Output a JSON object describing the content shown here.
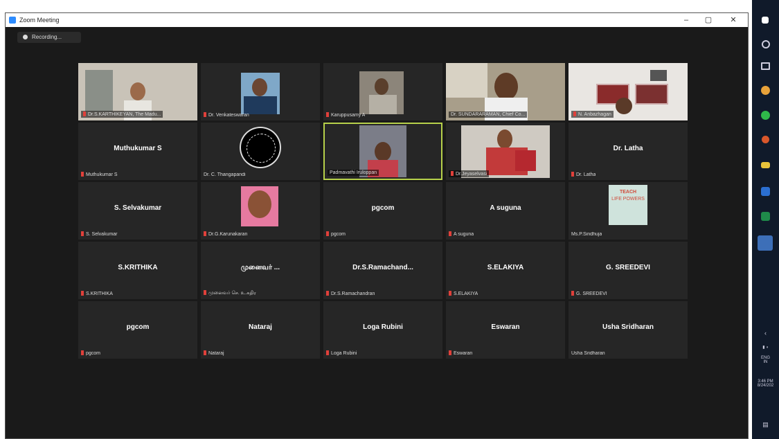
{
  "window": {
    "title": "Zoom Meeting"
  },
  "recording": {
    "label": "Recording..."
  },
  "participants": [
    {
      "display": "",
      "label": "Dr.S.KARTHIKEYAN, The Madu..."
    },
    {
      "display": "",
      "label": "Dr. Venkateswaran"
    },
    {
      "display": "",
      "label": "Karuppusamy A"
    },
    {
      "display": "",
      "label": "Dr. SUNDARARAMAN, Chief Co..."
    },
    {
      "display": "",
      "label": "N. Anbazhagan"
    },
    {
      "display": "Muthukumar S",
      "label": "Muthukumar S"
    },
    {
      "display": "",
      "label": "Dr. C. Thangapandi"
    },
    {
      "display": "",
      "label": "Padmavathi Iruloppan"
    },
    {
      "display": "",
      "label": "Dr.Jeyaselvasi"
    },
    {
      "display": "Dr. Latha",
      "label": "Dr. Latha"
    },
    {
      "display": "S. Selvakumar",
      "label": "S. Selvakumar"
    },
    {
      "display": "",
      "label": "Dr.G.Karunakaran"
    },
    {
      "display": "pgcom",
      "label": "pgcom"
    },
    {
      "display": "A suguna",
      "label": "A suguna"
    },
    {
      "display": "",
      "label": "Ms.P.Sindhuja"
    },
    {
      "display": "S.KRITHIKA",
      "label": "S.KRITHIKA"
    },
    {
      "display": "முனைவர் ...",
      "label": "முனைவர் செ. உ.கதிர"
    },
    {
      "display": "Dr.S.Ramachand...",
      "label": "Dr.S.Ramachandran"
    },
    {
      "display": "S.ELAKIYA",
      "label": "S.ELAKIYA"
    },
    {
      "display": "G. SREEDEVI",
      "label": "G. SREEDEVI"
    },
    {
      "display": "pgcom",
      "label": "pgcom"
    },
    {
      "display": "Nataraj",
      "label": "Nataraj"
    },
    {
      "display": "Loga Rubini",
      "label": "Loga Rubini"
    },
    {
      "display": "Eswaran",
      "label": "Eswaran"
    },
    {
      "display": "Usha Sridharan",
      "label": "Usha Sridharan"
    }
  ],
  "poster": {
    "line1": "TEACH",
    "line2": "LIFE POWERS"
  },
  "tray": {
    "lang": "ENG",
    "region": "IN",
    "time": "3:46 PM",
    "date": "8/24/202"
  },
  "colors": {
    "active_border": "#b7d14a",
    "muted_mic": "#e0403a",
    "zoom_blue": "#2d8cff"
  }
}
